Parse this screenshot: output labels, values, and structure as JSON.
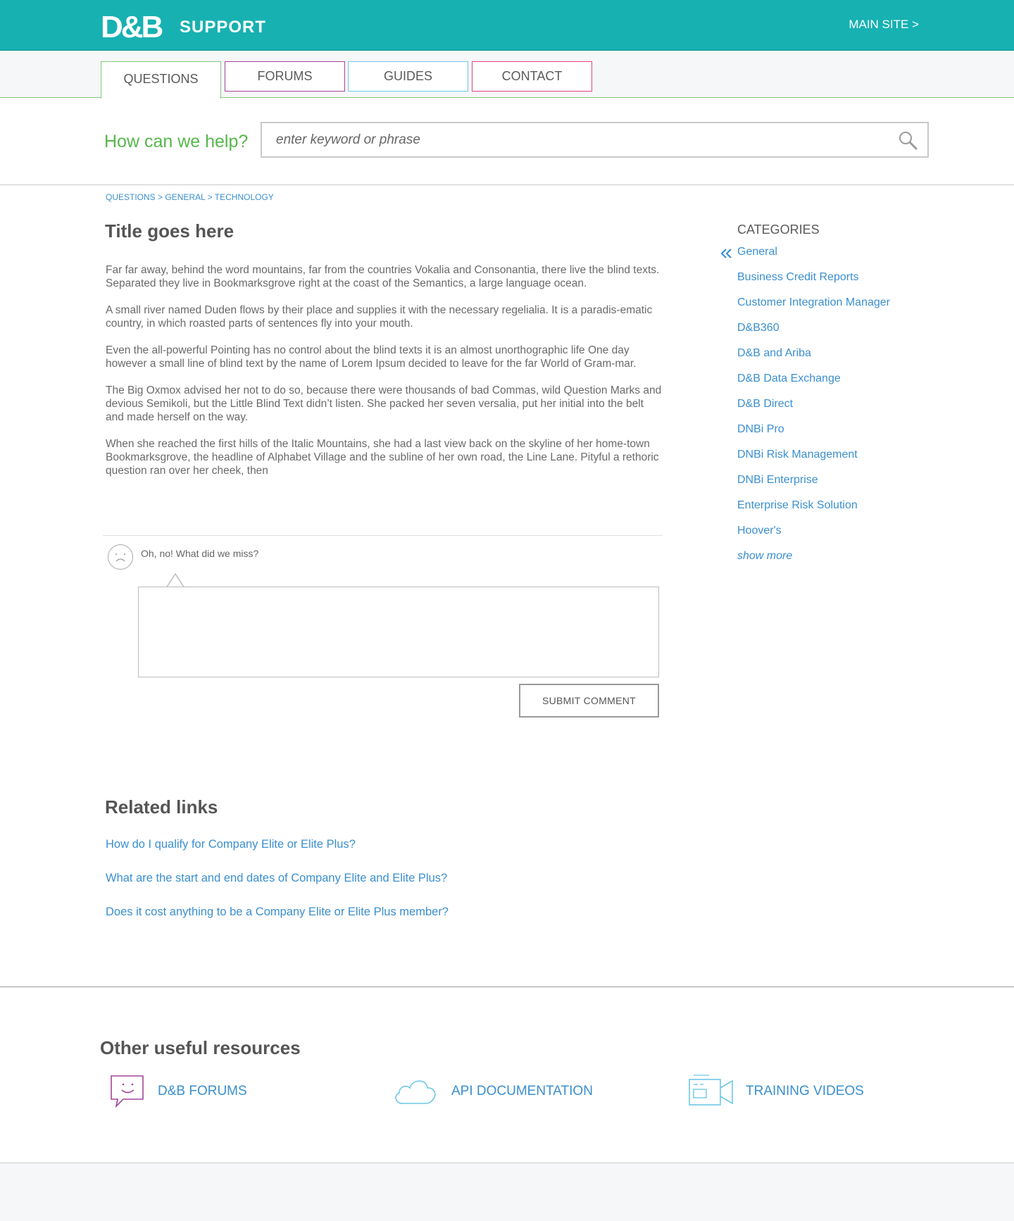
{
  "header": {
    "logo": "D&B",
    "logo_sub": "SUPPORT",
    "main_site": "MAIN SITE >"
  },
  "nav": {
    "tabs": [
      "QUESTIONS",
      "FORUMS",
      "GUIDES",
      "CONTACT"
    ],
    "tab_colors": [
      "#7fc97a",
      "#a4449a",
      "#6ec7e8",
      "#e2427f"
    ]
  },
  "search": {
    "label": "How can we help?",
    "placeholder": "enter keyword or phrase"
  },
  "breadcrumb": {
    "items": [
      "QUESTIONS",
      "GENERAL",
      "TECHNOLOGY"
    ],
    "separator": ">"
  },
  "article": {
    "title": "Title goes here",
    "paragraphs": [
      "Far far away, behind the word mountains, far from the countries Vokalia and Consonantia, there live the blind texts. Separated they live in Bookmarksgrove right at the coast of the Semantics, a large language ocean.",
      "A small river named Duden flows by their place and supplies it with the necessary regelialia. It is a paradis-ematic country, in which roasted parts of sentences fly into your mouth.",
      "Even the all-powerful Pointing has no control about the blind texts it is an almost unorthographic life One day however a small line of blind text by the name of Lorem Ipsum decided to leave for the far World of Gram-mar.",
      "The Big Oxmox advised her not to do so, because there were thousands of bad Commas, wild Question Marks and devious Semikoli, but the Little Blind Text didn’t listen. She packed her seven versalia, put her initial into the belt and made herself on the way.",
      "When she reached the first hills of the Italic Mountains, she had a last view back on the skyline of her home-town Bookmarksgrove, the headline of Alphabet Village and the subline of her own road, the Line Lane. Pityful a rethoric question ran over her cheek, then"
    ]
  },
  "feedback": {
    "prompt": "Oh, no! What did we miss?",
    "submit_label": "SUBMIT COMMENT"
  },
  "related": {
    "title": "Related links",
    "links": [
      "How do I qualify for Company Elite or Elite Plus?",
      "What are the start and end dates of Company Elite and Elite Plus?",
      "Does it cost anything to be a Company Elite or Elite Plus member?"
    ]
  },
  "categories": {
    "title": "CATEGORIES",
    "items": [
      "General",
      "Business Credit Reports",
      "Customer Integration Manager",
      "D&B360",
      "D&B and Ariba",
      "D&B Data Exchange",
      "D&B Direct",
      "DNBi Pro",
      "DNBi Risk Management",
      "DNBi Enterprise",
      "Enterprise Risk Solution",
      "Hoover's"
    ],
    "show_more": "show more",
    "active_icon": "double-chevron-left-icon"
  },
  "resources": {
    "title": "Other useful resources",
    "items": [
      {
        "label": "D&B FORUMS",
        "icon": "speech-bubble-smile-icon",
        "color": "#a4449a"
      },
      {
        "label": "API DOCUMENTATION",
        "icon": "cloud-icon",
        "color": "#3a8fcf"
      },
      {
        "label": "TRAINING VIDEOS",
        "icon": "video-camera-icon",
        "color": "#6ec7e8"
      }
    ]
  },
  "colors": {
    "brand_teal": "#17b1b2",
    "accent_green": "#56b74a",
    "link_blue": "#3a8fcf"
  }
}
